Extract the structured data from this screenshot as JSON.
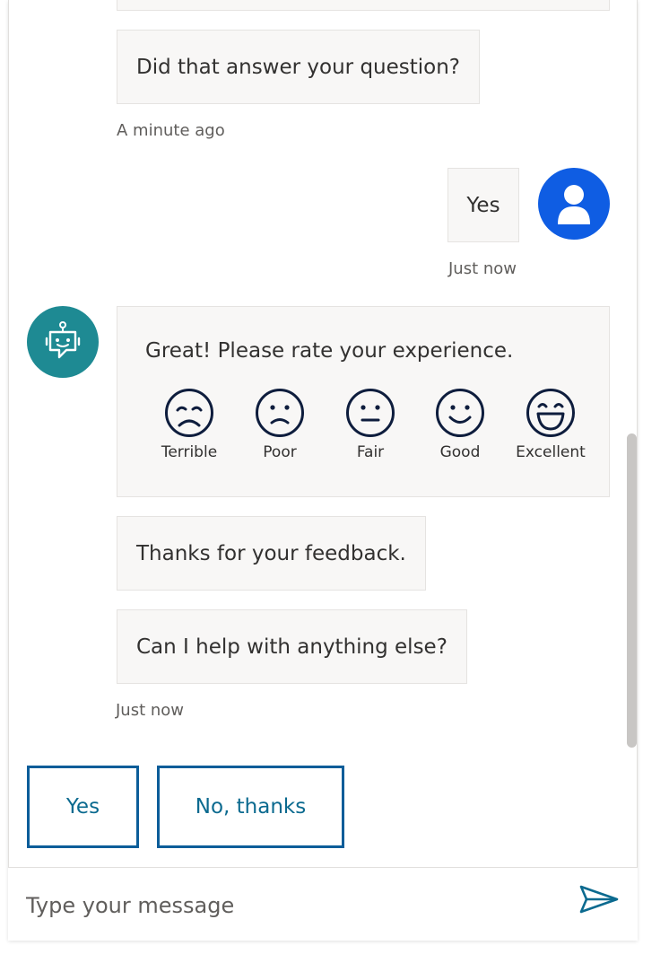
{
  "colors": {
    "bot_avatar": "#1e8a93",
    "user_avatar": "#0f5de3",
    "emoji_stroke": "#0e1d3d",
    "accent_border": "#0b5d99",
    "accent_text": "#0b6a8f"
  },
  "transcript": {
    "msg_did_that_answer": "Did that answer your question?",
    "ts_minute_ago": "A minute ago",
    "user_reply": "Yes",
    "ts_user_just_now": "Just now",
    "rating_prompt": "Great! Please rate your experience.",
    "rating_options": [
      {
        "label": "Terrible",
        "icon": "terrible-face-icon"
      },
      {
        "label": "Poor",
        "icon": "poor-face-icon"
      },
      {
        "label": "Fair",
        "icon": "fair-face-icon"
      },
      {
        "label": "Good",
        "icon": "good-face-icon"
      },
      {
        "label": "Excellent",
        "icon": "excellent-face-icon"
      }
    ],
    "msg_thanks": "Thanks for your feedback.",
    "msg_anything_else": "Can I help with anything else?",
    "ts_bot_just_now": "Just now"
  },
  "suggested_actions": [
    "Yes",
    "No, thanks"
  ],
  "composer": {
    "placeholder": "Type your message",
    "send_icon": "send-icon"
  }
}
